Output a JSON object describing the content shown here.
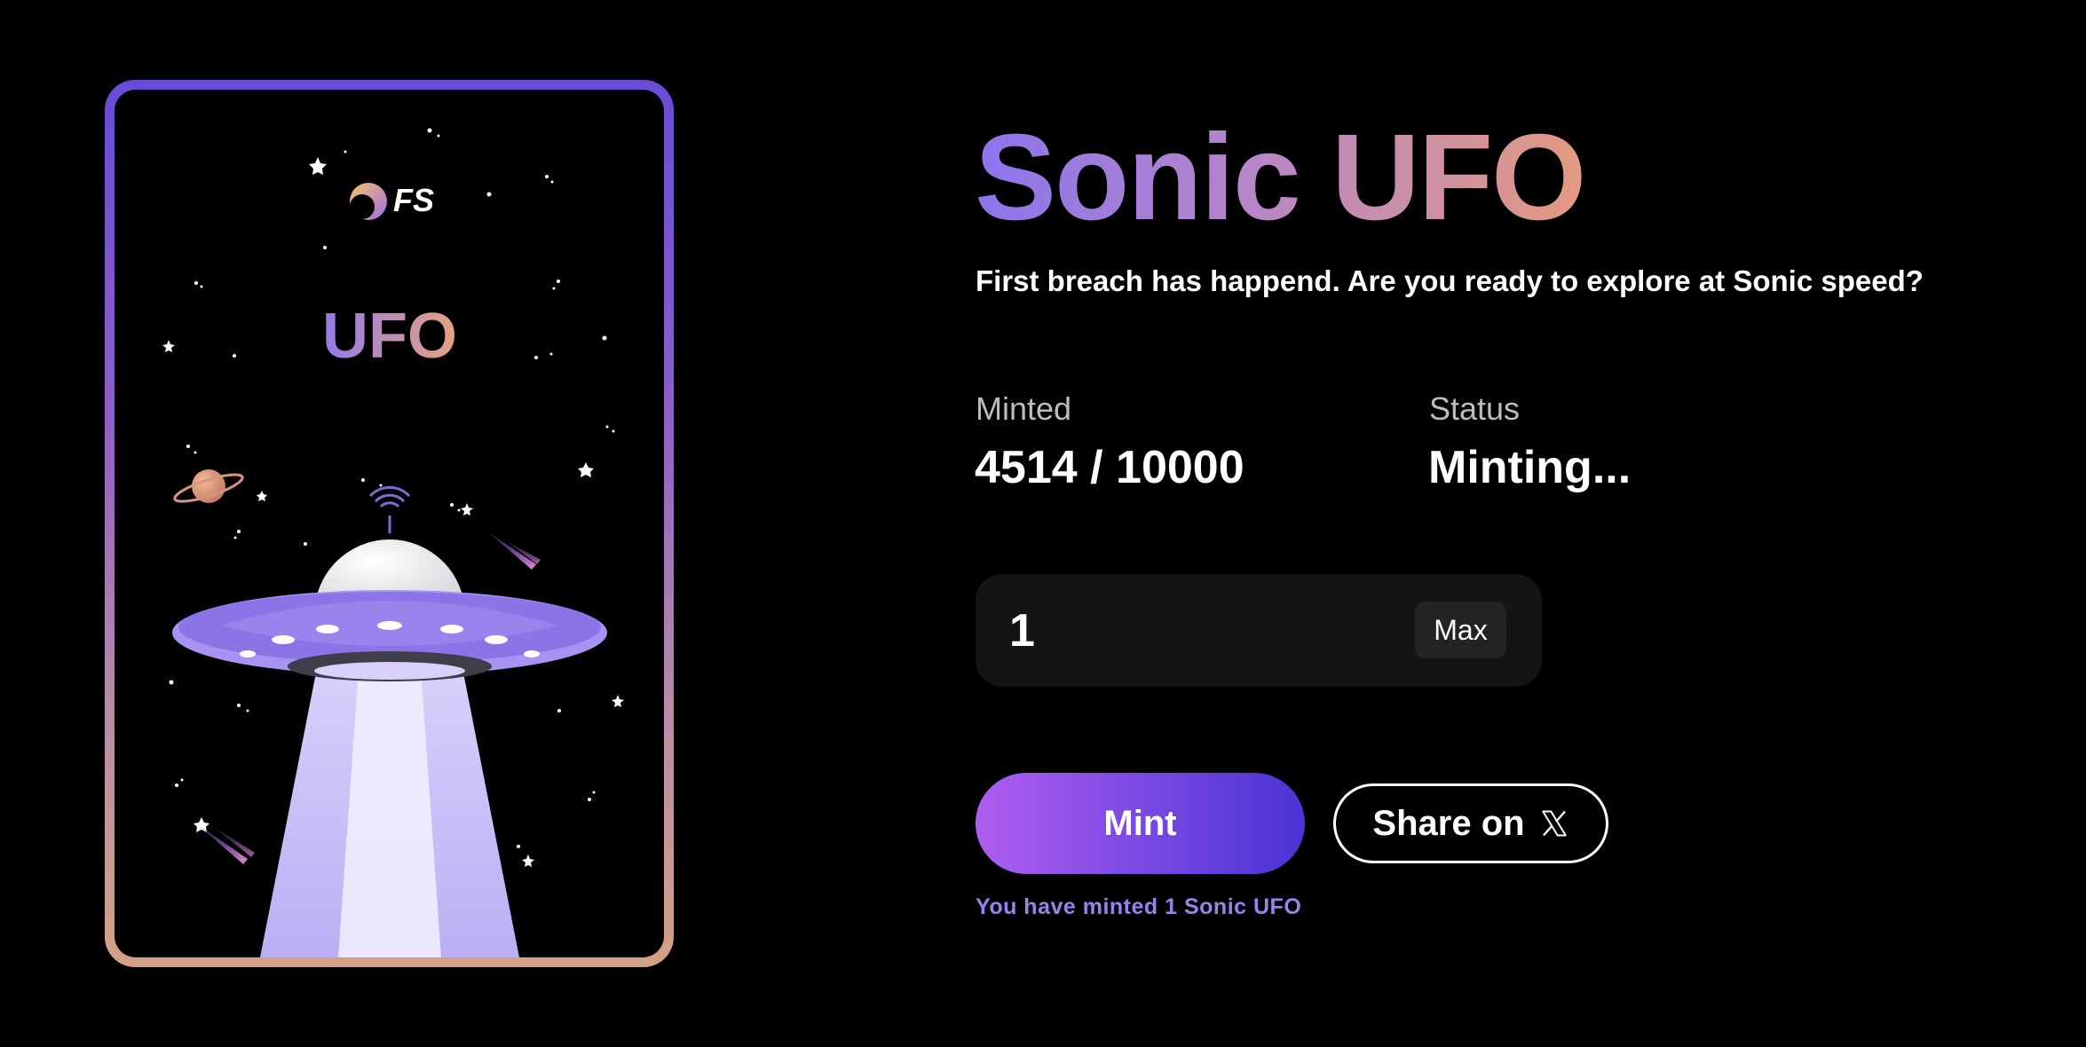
{
  "card": {
    "logo_text": "FS",
    "label": "UFO"
  },
  "hero": {
    "title": "Sonic UFO",
    "subtitle": "First breach has happend. Are you ready to explore at Sonic speed?"
  },
  "stats": {
    "minted_label": "Minted",
    "minted_value": "4514 / 10000",
    "status_label": "Status",
    "status_value": "Minting..."
  },
  "mint_form": {
    "quantity_value": "1",
    "max_label": "Max",
    "mint_label": "Mint",
    "share_label": "Share on",
    "share_icon": "x-logo-icon",
    "minted_note": "You have minted 1 Sonic UFO"
  },
  "colors": {
    "background": "#000000",
    "accent_purple": "#8c74ee",
    "accent_peach": "#e39a80",
    "note_color": "#9a82ee"
  }
}
